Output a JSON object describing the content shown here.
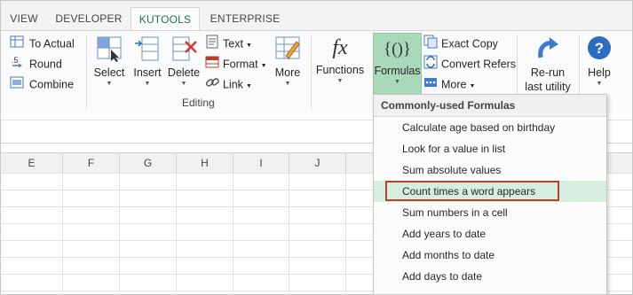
{
  "tabs": [
    "VIEW",
    "DEVELOPER",
    "KUTOOLS",
    "ENTERPRISE"
  ],
  "ribbon": {
    "left_items": [
      "To Actual",
      "Round",
      "Combine"
    ],
    "select": "Select",
    "insert": "Insert",
    "delete": "Delete",
    "text": "Text",
    "format": "Format",
    "link": "Link",
    "more": "More",
    "editing_label": "Editing",
    "functions": "Functions",
    "formulas": "Formulas",
    "exact_copy": "Exact Copy",
    "convert_refers": "Convert Refers",
    "more2": "More",
    "rerun_line1": "Re-run",
    "rerun_line2": "last utility",
    "help": "Help"
  },
  "columns": [
    "E",
    "F",
    "G",
    "H",
    "I",
    "J"
  ],
  "menu": {
    "header": "Commonly-used Formulas",
    "items": [
      "Calculate age based on birthday",
      "Look for a value in list",
      "Sum absolute values",
      "Count times a word appears",
      "Sum numbers in a cell",
      "Add years to date",
      "Add months to date",
      "Add days to date"
    ],
    "highlighted_index": 3
  },
  "colors": {
    "accent": "#217346",
    "formulas_bg": "#a9d9b9",
    "highlight_border": "#b3432d",
    "highlight_bg": "#d6eedf"
  }
}
